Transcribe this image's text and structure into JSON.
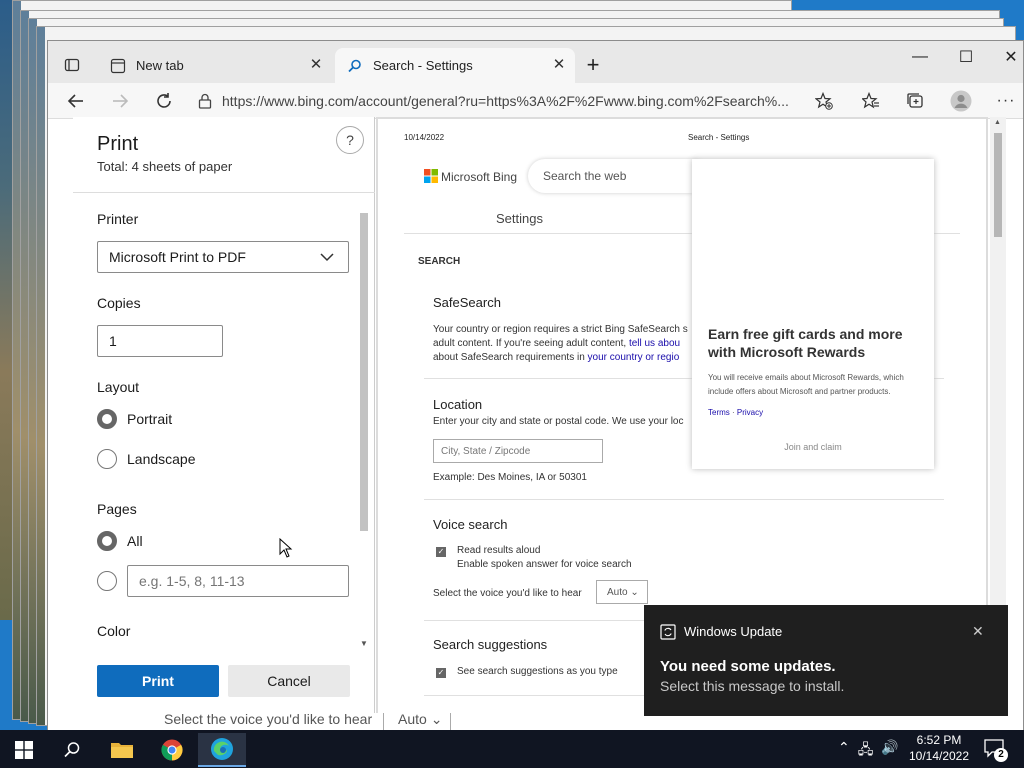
{
  "browser": {
    "tabs": [
      {
        "label": "New tab"
      },
      {
        "label": "Search - Settings"
      }
    ],
    "url": "https://www.bing.com/account/general?ru=https%3A%2F%2Fwww.bing.com%2Fsearch%...",
    "new_tab_symbol": "+",
    "window_controls": {
      "minimize": "—",
      "maximize": "☐",
      "close": "✕"
    }
  },
  "print_dialog": {
    "title": "Print",
    "total": "Total: 4 sheets of paper",
    "help": "?",
    "printer_label": "Printer",
    "printer_value": "Microsoft Print to PDF",
    "copies_label": "Copies",
    "copies_value": "1",
    "layout_label": "Layout",
    "layout_options": [
      "Portrait",
      "Landscape"
    ],
    "layout_selected": "Portrait",
    "pages_label": "Pages",
    "pages_all": "All",
    "pages_placeholder": "e.g. 1-5, 8, 11-13",
    "color_label": "Color",
    "print_button": "Print",
    "cancel_button": "Cancel"
  },
  "preview": {
    "date": "10/14/2022",
    "header_title": "Search - Settings",
    "brand": "Microsoft Bing",
    "search_placeholder": "Search the web",
    "settings_heading": "Settings",
    "section_search": "SEARCH",
    "safesearch_title": "SafeSearch",
    "safesearch_line1": "Your country or region requires a strict Bing SafeSearch s",
    "safesearch_line2_a": "adult content. If you're seeing adult content, ",
    "safesearch_line2_link": "tell us abou",
    "safesearch_line3_a": "about SafeSearch requirements in ",
    "safesearch_line3_link": "your country or regio",
    "location_title": "Location",
    "location_text": "Enter your city and state or postal code. We use your loc",
    "location_placeholder": "City, State / Zipcode",
    "location_example": "Example: Des Moines, IA or 50301",
    "voice_title": "Voice search",
    "voice_read": "Read results aloud",
    "voice_enable": "Enable spoken answer for voice search",
    "voice_select": "Select the voice you'd like to hear",
    "voice_value": "Auto",
    "suggest_title": "Search suggestions",
    "suggest_text": "See search suggestions as you type",
    "rewards_title": "Earn free gift cards and more with Microsoft Rewards",
    "rewards_body": "You will receive emails about Microsoft Rewards, which include offers about Microsoft and partner products.",
    "rewards_terms": "Terms",
    "rewards_sep": " · ",
    "rewards_privacy": "Privacy",
    "rewards_cta": "Join and claim"
  },
  "background_page": {
    "voice_select": "Select the voice you'd like to hear",
    "voice_value": "Auto"
  },
  "toast": {
    "app": "Windows Update",
    "title": "You need some updates.",
    "body": "Select this message to install.",
    "close": "✕"
  },
  "taskbar": {
    "time": "6:52 PM",
    "date": "10/14/2022",
    "notification_count": "2"
  },
  "colors": {
    "accent": "#0f6cbd",
    "link": "#1a0dab",
    "toast_bg": "#1f1f1f",
    "taskbar_bg": "#101522"
  }
}
